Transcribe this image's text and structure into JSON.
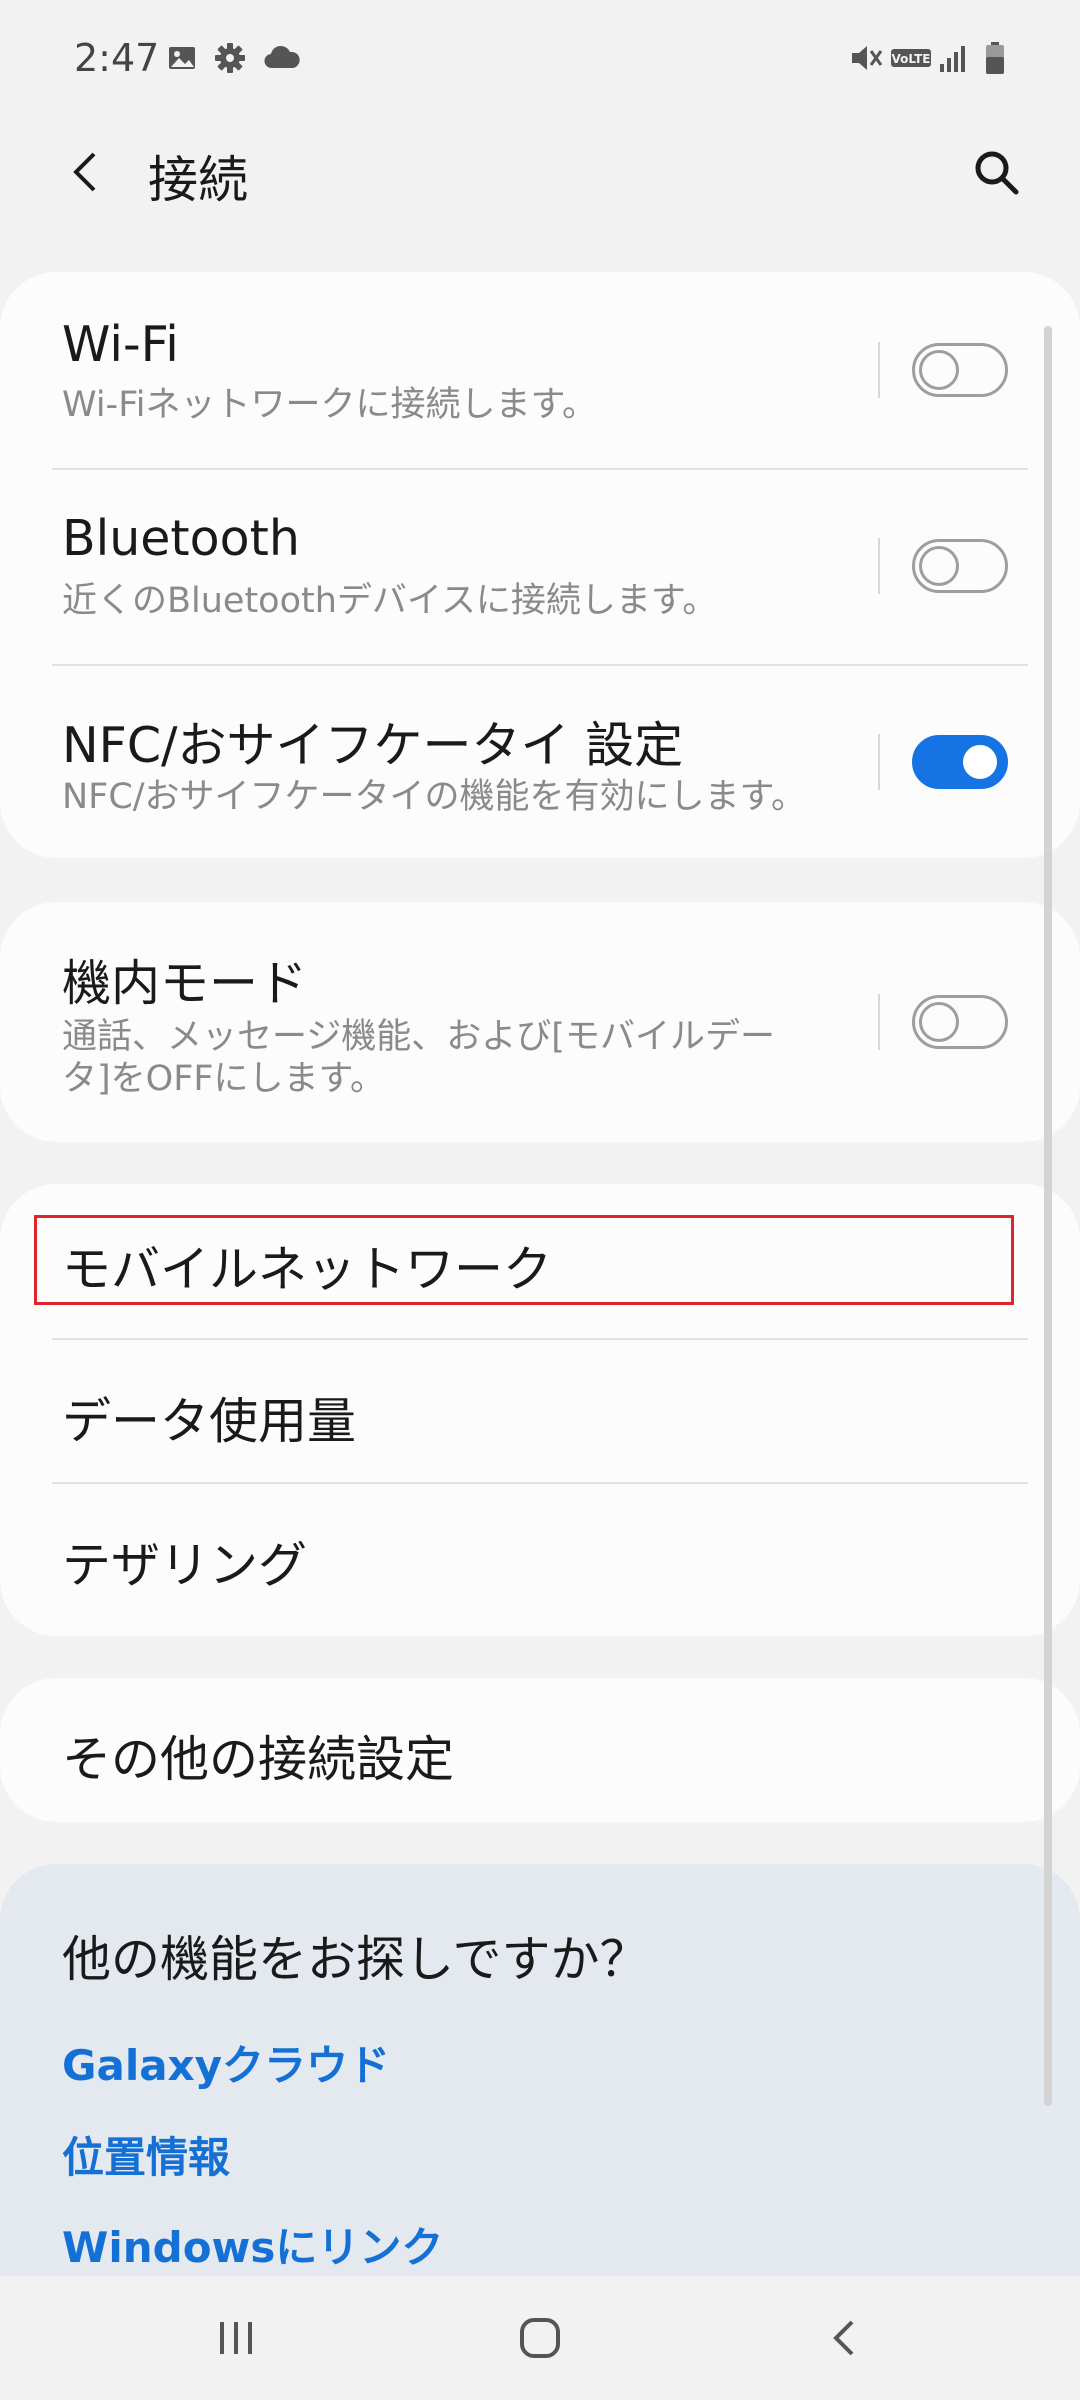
{
  "status_bar": {
    "time": "2:47",
    "left_icons": [
      "image-icon",
      "gear-icon",
      "cloud-icon"
    ],
    "right_icons": [
      "mute-vibrate-icon",
      "volte-icon",
      "signal-icon",
      "battery-icon"
    ],
    "volte_label": "VoLTE"
  },
  "header": {
    "title": "接続",
    "back_icon": "back-arrow-icon",
    "search_icon": "search-icon"
  },
  "connection_card": {
    "wifi": {
      "title": "Wi-Fi",
      "subtitle": "Wi-Fiネットワークに接続します。",
      "enabled": false
    },
    "bluetooth": {
      "title": "Bluetooth",
      "subtitle": "近くのBluetoothデバイスに接続します。",
      "enabled": false
    },
    "nfc": {
      "title": "NFC/おサイフケータイ 設定",
      "subtitle": "NFC/おサイフケータイの機能を有効にします。",
      "enabled": true
    }
  },
  "airplane_card": {
    "airplane": {
      "title": "機内モード",
      "subtitle": "通話、メッセージ機能、および[モバイルデータ]をOFFにします。",
      "enabled": false
    }
  },
  "network_card": {
    "items": [
      "モバイルネットワーク",
      "データ使用量",
      "テザリング"
    ]
  },
  "other_card": {
    "label": "その他の接続設定"
  },
  "suggestions": {
    "title": "他の機能をお探しですか？",
    "links": [
      "Galaxyクラウド",
      "位置情報",
      "Windowsにリンク"
    ]
  },
  "colors": {
    "accent": "#1673e4",
    "link": "#1570d6",
    "highlight_border": "#e0242b",
    "background": "#f2f2f2",
    "card": "#fcfcfc",
    "suggest_bg": "#e3e9ef"
  }
}
